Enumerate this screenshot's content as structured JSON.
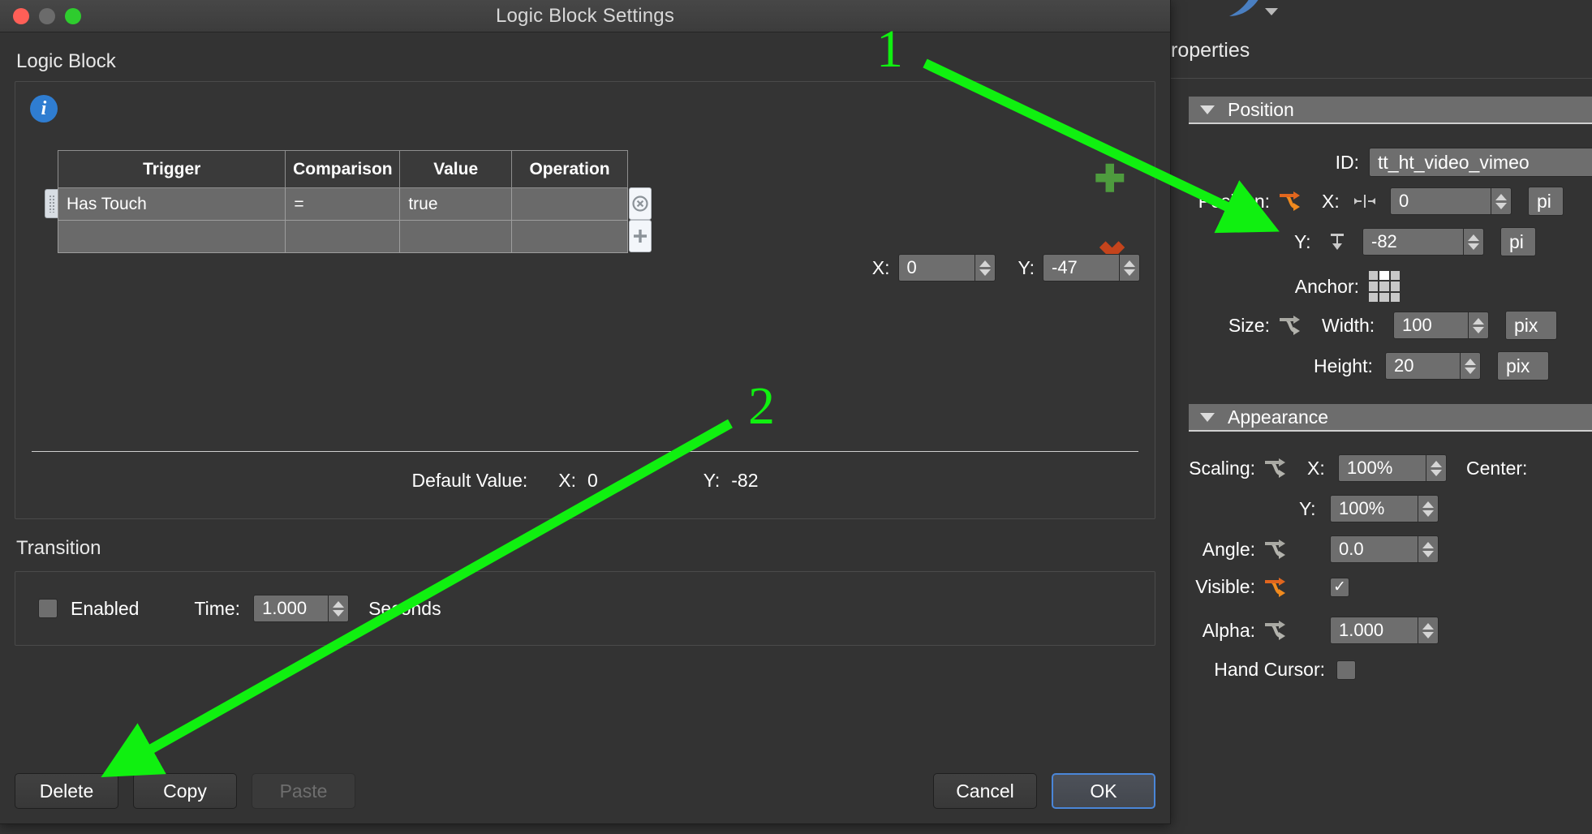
{
  "dialog": {
    "title": "Logic Block Settings",
    "traffic_lights": [
      "close",
      "minimize",
      "zoom"
    ],
    "section_label": "Logic Block",
    "info_glyph": "i",
    "table": {
      "headers": [
        "Trigger",
        "Comparison",
        "Value",
        "Operation"
      ],
      "rows": [
        {
          "trigger": "Has Touch",
          "comparison": "=",
          "value": "true",
          "operation": ""
        },
        {
          "trigger": "",
          "comparison": "",
          "value": "",
          "operation": ""
        }
      ],
      "row_remove_glyph": "ⓧ",
      "row_add_glyph": "+"
    },
    "add_rule_glyph": "✚",
    "delete_rule_glyph": "✖",
    "offset": {
      "x_label": "X:",
      "x_value": "0",
      "y_label": "Y:",
      "y_value": "-47"
    },
    "default_value": {
      "label": "Default Value:",
      "x_label": "X:",
      "x_value": "0",
      "y_label": "Y:",
      "y_value": "-82"
    },
    "transition": {
      "label": "Transition",
      "enabled_label": "Enabled",
      "enabled_checked": false,
      "time_label": "Time:",
      "time_value": "1.000",
      "seconds_label": "Seconds"
    },
    "buttons": {
      "delete": "Delete",
      "copy": "Copy",
      "paste": "Paste",
      "cancel": "Cancel",
      "ok": "OK"
    }
  },
  "right_panel": {
    "title": "roperties",
    "position_section": {
      "header": "Position",
      "id_label": "ID:",
      "id_value": "tt_ht_video_vimeo",
      "position_label": "Position:",
      "x_label": "X:",
      "x_value": "0",
      "x_unit": "pi",
      "y_label": "Y:",
      "y_value": "-82",
      "y_unit": "pi",
      "anchor_label": "Anchor:",
      "anchor_selected": "top-center",
      "size_label": "Size:",
      "width_label": "Width:",
      "width_value": "100",
      "width_unit": "pix",
      "height_label": "Height:",
      "height_value": "20",
      "height_unit": "pix"
    },
    "appearance_section": {
      "header": "Appearance",
      "scaling_label": "Scaling:",
      "scaling_x_label": "X:",
      "scaling_x_value": "100%",
      "center_label": "Center:",
      "scaling_y_label": "Y:",
      "scaling_y_value": "100%",
      "angle_label": "Angle:",
      "angle_value": "0.0",
      "visible_label": "Visible:",
      "visible_checked": true,
      "alpha_label": "Alpha:",
      "alpha_value": "1.000",
      "hand_cursor_label": "Hand Cursor:"
    }
  },
  "annotations": {
    "items": [
      {
        "number": "1"
      },
      {
        "number": "2"
      }
    ],
    "color": "#10f010"
  }
}
